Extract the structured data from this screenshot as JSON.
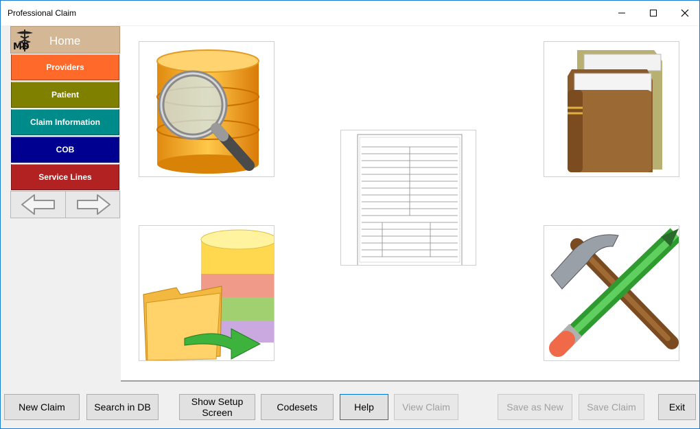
{
  "window": {
    "title": "Professional Claim"
  },
  "sidebar": {
    "home_label": "Home",
    "logo_text": "MD",
    "items": [
      {
        "label": "Providers",
        "color": "#ff6a2a"
      },
      {
        "label": "Patient",
        "color": "#808000"
      },
      {
        "label": "Claim Information",
        "color": "#008b8b"
      },
      {
        "label": "COB",
        "color": "#000090"
      },
      {
        "label": "Service Lines",
        "color": "#b22222"
      }
    ]
  },
  "tiles": [
    {
      "name": "database-search-icon"
    },
    {
      "name": "books-icon"
    },
    {
      "name": "claim-form-icon"
    },
    {
      "name": "database-import-icon"
    },
    {
      "name": "tools-icon"
    }
  ],
  "buttons": {
    "new_claim": "New Claim",
    "search_db": "Search in DB",
    "show_setup_line1": "Show Setup",
    "show_setup_line2": "Screen",
    "codesets": "Codesets",
    "help": "Help",
    "view_claim": "View Claim",
    "save_as_new": "Save as New",
    "save_claim": "Save Claim",
    "exit": "Exit"
  }
}
